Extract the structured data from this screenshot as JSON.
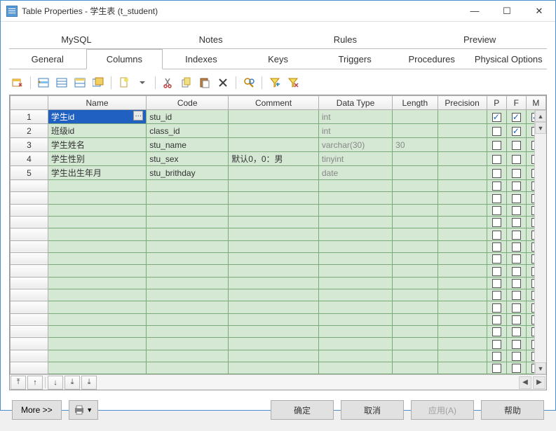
{
  "window": {
    "title": "Table Properties - 学生表 (t_student)"
  },
  "tabs1": [
    "MySQL",
    "Notes",
    "Rules",
    "Preview"
  ],
  "tabs2": [
    "General",
    "Columns",
    "Indexes",
    "Keys",
    "Triggers",
    "Procedures",
    "Physical Options"
  ],
  "activeTab": "Columns",
  "grid": {
    "headers": [
      "",
      "Name",
      "Code",
      "Comment",
      "Data Type",
      "Length",
      "Precision",
      "P",
      "F",
      "M"
    ],
    "rows": [
      {
        "n": "1",
        "name": "学生id",
        "code": "stu_id",
        "comment": "",
        "dtype": "int",
        "len": "",
        "prec": "",
        "p": true,
        "f": true,
        "m": true,
        "sel": true
      },
      {
        "n": "2",
        "name": "班级id",
        "code": "class_id",
        "comment": "",
        "dtype": "int",
        "len": "",
        "prec": "",
        "p": false,
        "f": true,
        "m": false
      },
      {
        "n": "3",
        "name": "学生姓名",
        "code": "stu_name",
        "comment": "",
        "dtype": "varchar(30)",
        "len": "30",
        "prec": "",
        "p": false,
        "f": false,
        "m": false
      },
      {
        "n": "4",
        "name": "学生性别",
        "code": "stu_sex",
        "comment": "默认0，0：男",
        "dtype": "tinyint",
        "len": "",
        "prec": "",
        "p": false,
        "f": false,
        "m": false
      },
      {
        "n": "5",
        "name": "学生出生年月",
        "code": "stu_brithday",
        "comment": "",
        "dtype": "date",
        "len": "",
        "prec": "",
        "p": false,
        "f": false,
        "m": false
      }
    ],
    "emptyRows": 16
  },
  "footer": {
    "more": "More >>",
    "ok": "确定",
    "cancel": "取消",
    "apply": "应用(A)",
    "help": "帮助"
  },
  "toolbarIcons": [
    "properties",
    "grid1",
    "grid2",
    "grid3",
    "grid4",
    "add",
    "cut",
    "copy",
    "paste",
    "delete",
    "find",
    "filter1",
    "filter2"
  ]
}
